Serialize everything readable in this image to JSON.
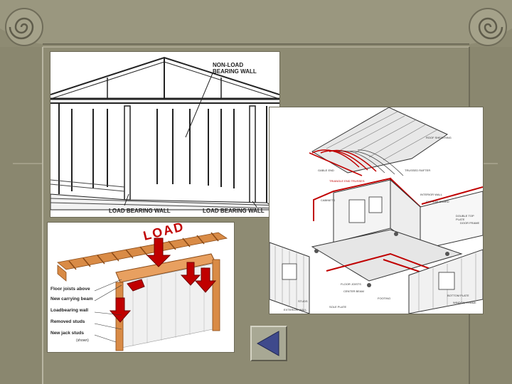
{
  "diagram1": {
    "label_non_load": "NON-LOAD BEARING WALL",
    "label_load_left": "LOAD BEARING WALL",
    "label_load_right": "LOAD BEARING WALL"
  },
  "diagram2": {
    "labels": {
      "roof_sheathing": "ROOF SHEATHING",
      "trussed_rafter": "TRUSSED RAFTER",
      "gable_end": "GABLE END",
      "triangle_end_trusses": "TRIANGLE END TRUSSES",
      "interior_wall": "INTERIOR WALL",
      "gypsum_board": "GYPSUM BOARD",
      "cabinets": "CABINETS",
      "double_top_plate": "DOUBLE TOP PLATE",
      "door_frame": "DOOR FRAME",
      "floor_joists": "FLOOR JOISTS",
      "center_beam": "CENTER BEAM",
      "exterior_wall": "EXTERIOR WALL",
      "bottom_plate": "BOTTOM PLATE",
      "window_frame": "WINDOW FRAME",
      "footing": "FOOTING",
      "studs": "STUDS",
      "sole_plate": "SOLE PLATE"
    }
  },
  "diagram3": {
    "load_title": "LOAD",
    "callouts": [
      "Floor joists above",
      "New carrying beam",
      "Loadbearing wall",
      "Removed studs",
      "New jack studs"
    ],
    "note": "(shown)"
  },
  "nav": {
    "back_icon": "triangle-left-icon"
  },
  "colors": {
    "frame": "#8e8b73",
    "accent_red": "#c00000",
    "lumber": "#d98b46"
  }
}
